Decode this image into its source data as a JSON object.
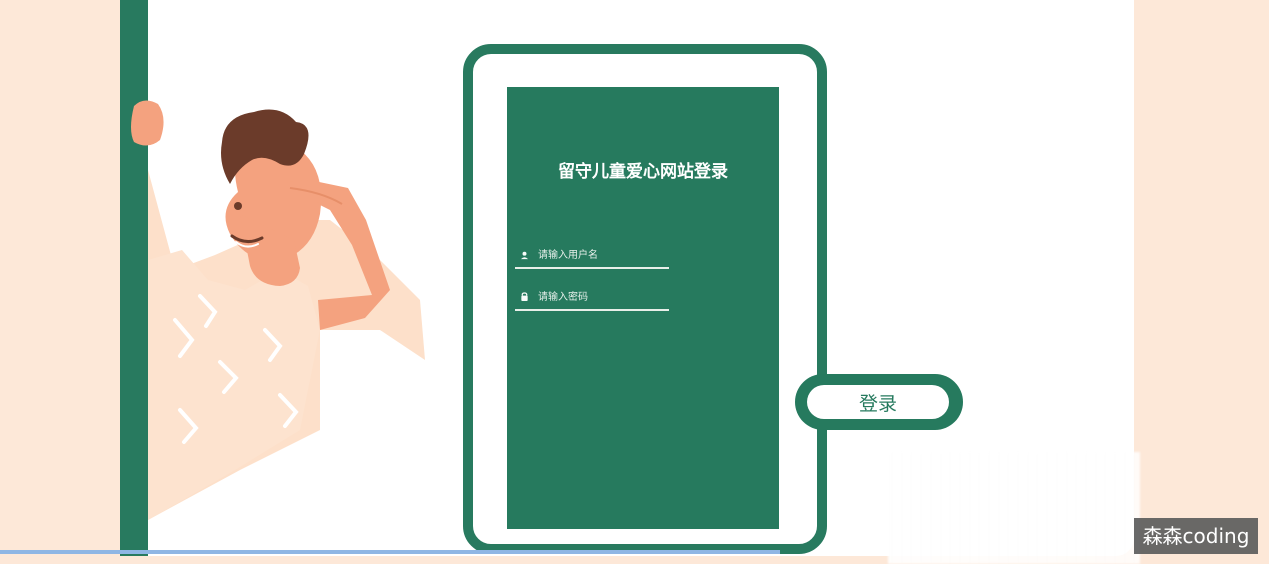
{
  "login": {
    "title": "留守儿童爱心网站登录",
    "username_placeholder": "请输入用户名",
    "password_placeholder": "请输入密码",
    "button_label": "登录"
  },
  "watermark": {
    "text": "森森coding"
  },
  "colors": {
    "brand": "#267a5e",
    "page_bg": "#fde8d8",
    "card_bg": "#ffffff"
  },
  "icons": {
    "username": "user-icon",
    "password": "lock-icon"
  }
}
